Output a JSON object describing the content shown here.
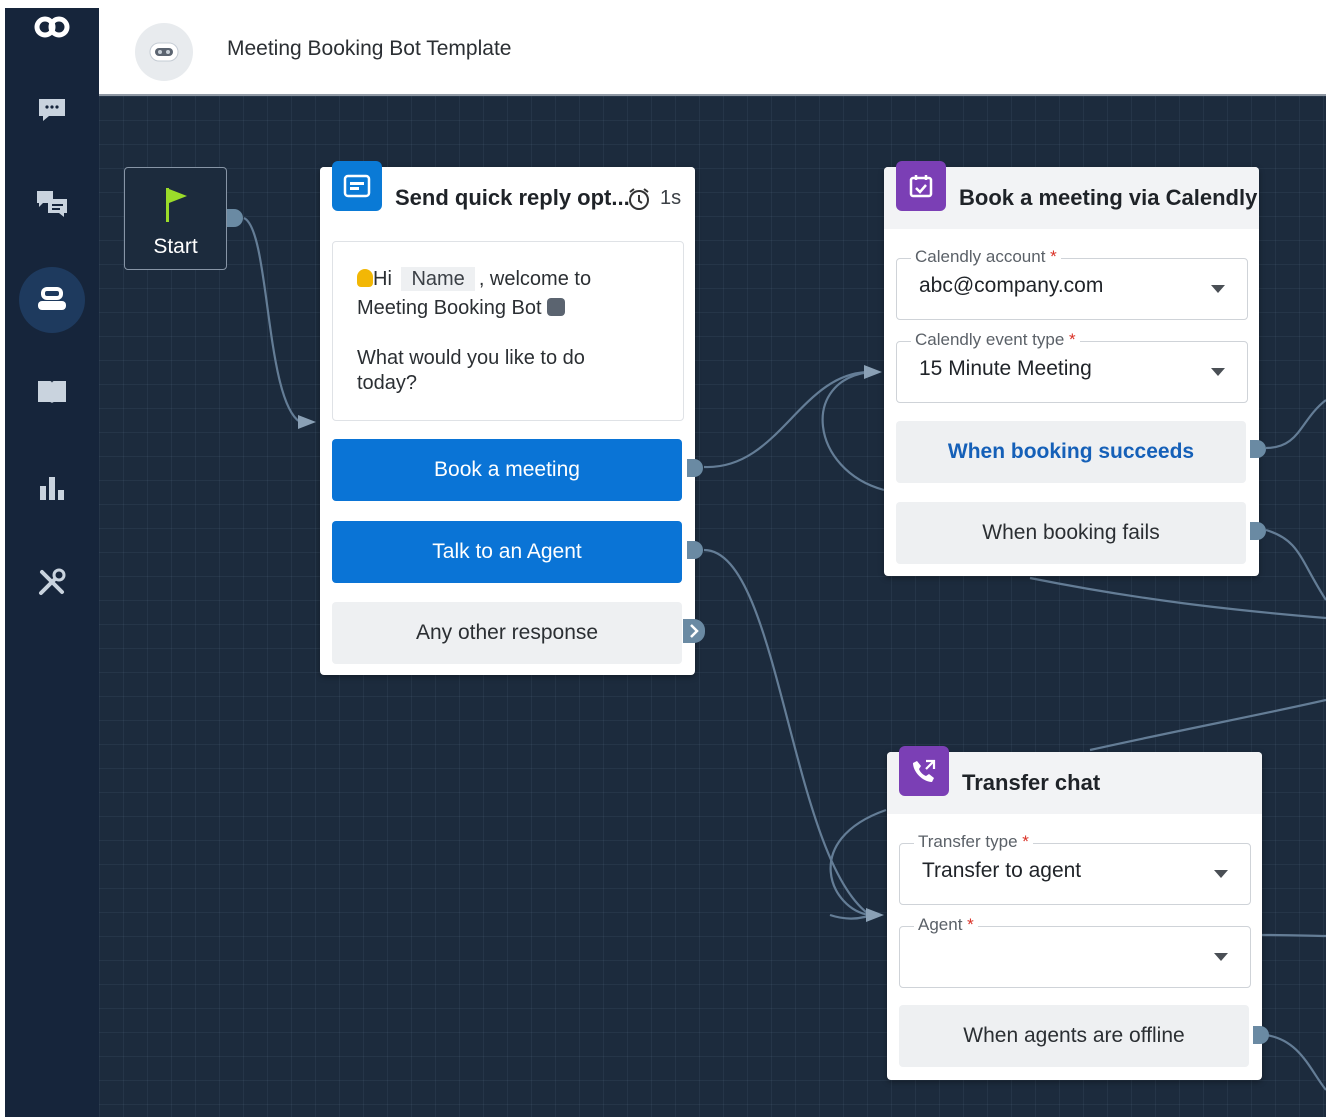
{
  "app": {
    "logo_icon": "infinity-logo-icon",
    "accent": "#0a74d6",
    "sidebar_bg": "#16253b",
    "canvas_bg": "#1c2b3d"
  },
  "sidebar": {
    "items": [
      {
        "icon": "chat-icon",
        "active": false
      },
      {
        "icon": "translate-chat-icon",
        "active": false
      },
      {
        "icon": "bot-icon",
        "active": true
      },
      {
        "icon": "book-icon",
        "active": false
      },
      {
        "icon": "bar-chart-icon",
        "active": false
      },
      {
        "icon": "tools-icon",
        "active": false
      }
    ]
  },
  "header": {
    "title": "Meeting Booking Bot Template",
    "avatar_icon": "robot-avatar-icon"
  },
  "start_node": {
    "label": "Start",
    "icon": "flag-icon"
  },
  "quick_reply": {
    "title": "Send quick reply opt...",
    "delay": "1s",
    "message": {
      "greeting": "Hi",
      "name_chip": "Name",
      "after_chip": ", welcome to",
      "line2": "Meeting Booking Bot",
      "question_line1": "What would you like to do",
      "question_line2": "today?"
    },
    "options": [
      "Book a meeting",
      "Talk to an Agent",
      "Any other response"
    ]
  },
  "calendly": {
    "title": "Book a meeting via Calendly",
    "account_label": "Calendly account",
    "account_value": "abc@company.com",
    "event_label": "Calendly event type",
    "event_value": "15 Minute Meeting",
    "success": "When booking succeeds",
    "fail": "When booking fails"
  },
  "transfer": {
    "title": "Transfer chat",
    "type_label": "Transfer type",
    "type_value": "Transfer to agent",
    "agent_label": "Agent",
    "agent_value": "",
    "offline": "When agents are offline"
  }
}
